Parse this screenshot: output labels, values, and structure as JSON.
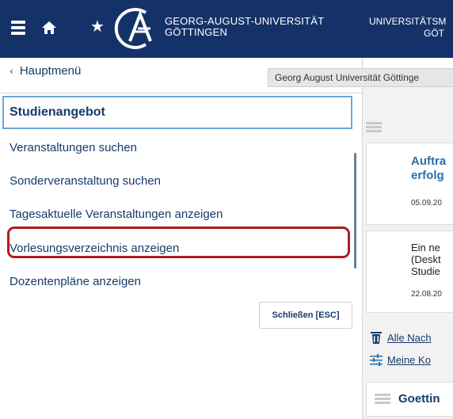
{
  "header": {
    "star": "★",
    "university_line1": "GEORG-AUGUST-UNIVERSITÄT",
    "university_line2": "GÖTTINGEN",
    "right_line1": "UNIVERSITÄTSM",
    "right_line2": "GÖT",
    "colors": {
      "bar": "#153268",
      "text": "#ffffff"
    }
  },
  "tooltip": "Georg August Universität Göttinge",
  "menu": {
    "back_label": "Hauptmenü",
    "back_icon": "‹",
    "title": "Studienangebot",
    "items": [
      {
        "label": "Veranstaltungen suchen"
      },
      {
        "label": "Sonderveranstaltung suchen"
      },
      {
        "label": "Tagesaktuelle Veranstaltungen anzeigen"
      },
      {
        "label": "Vorlesungsverzeichnis anzeigen",
        "highlighted": true
      },
      {
        "label": "Dozentenpläne anzeigen"
      }
    ],
    "close_label": "Schließen [ESC]",
    "highlight_color": "#b01c1c",
    "focus_color": "#6aa7d8"
  },
  "background": {
    "card1": {
      "title_line1": "Auftra",
      "title_line2": "erfolg",
      "date": "05.09.20"
    },
    "card2": {
      "line1": "Ein ne",
      "line2": "(Deskt",
      "line3": "Studie",
      "date": "22.08.20"
    },
    "link1": "Alle Nach",
    "link2": "Meine Ko",
    "section_title": "Goettin"
  }
}
